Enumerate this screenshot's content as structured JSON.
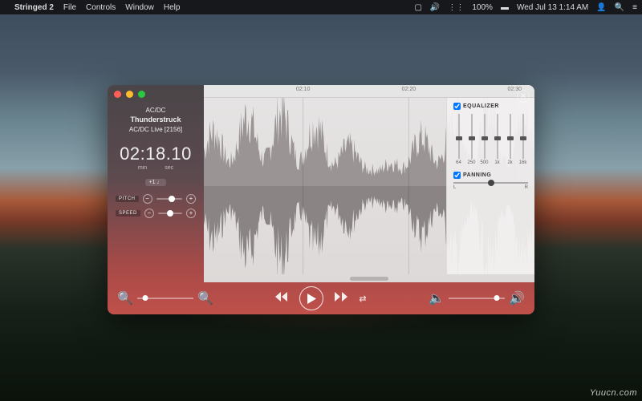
{
  "menubar": {
    "app": "Stringed 2",
    "items": [
      "File",
      "Controls",
      "Window",
      "Help"
    ],
    "battery": "100%",
    "clock": "Wed Jul 13  1:14 AM"
  },
  "track": {
    "artist": "AC/DC",
    "title": "Thunderstruck",
    "album": "AC/DC Live [2156]"
  },
  "time": {
    "display": "02:18.10",
    "min_label": "min",
    "sec_label": "sec"
  },
  "badge": "+1 ♩",
  "pitch": {
    "label": "PITCH",
    "value_pct": 60
  },
  "speed": {
    "label": "SPEED",
    "value_pct": 50
  },
  "ruler": {
    "marks": [
      "02:10",
      "02:20",
      "02:30"
    ],
    "positions_pct": [
      30,
      62,
      94
    ]
  },
  "eq": {
    "label": "EQUALIZER",
    "enabled": true,
    "bands": [
      {
        "freq": "64",
        "pos": 50
      },
      {
        "freq": "250",
        "pos": 50
      },
      {
        "freq": "500",
        "pos": 50
      },
      {
        "freq": "1k",
        "pos": 50
      },
      {
        "freq": "2k",
        "pos": 50
      },
      {
        "freq": "16k",
        "pos": 50
      }
    ]
  },
  "panning": {
    "label": "PANNING",
    "enabled": true,
    "left": "L",
    "right": "R",
    "value_pct": 50
  },
  "transport": {
    "zoom_pct": 15,
    "volume_pct": 85
  },
  "watermark": "Yuucn.com"
}
